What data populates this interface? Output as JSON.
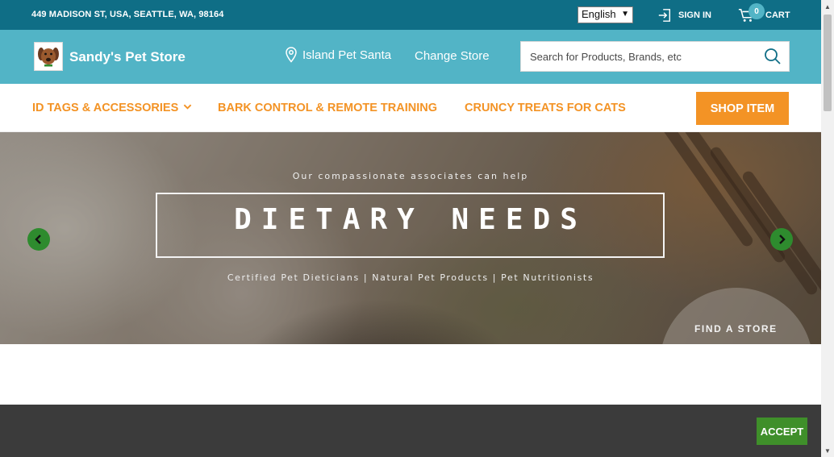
{
  "topbar": {
    "address": "449 MADISON ST, USA, SEATTLE, WA, 98164",
    "language": "English",
    "signin_label": "SIGN IN",
    "cart_label": "CART",
    "cart_count": "0"
  },
  "header": {
    "brand_name": "Sandy's Pet Store",
    "store_name": "Island Pet Santa",
    "change_store_label": "Change Store",
    "search_placeholder": "Search for Products, Brands, etc"
  },
  "nav": {
    "items": [
      {
        "label": "ID TAGS & ACCESSORIES",
        "has_dropdown": true
      },
      {
        "label": "BARK CONTROL & REMOTE TRAINING"
      },
      {
        "label": "CRUNCY TREATS FOR CATS"
      }
    ],
    "shop_button": "SHOP ITEM"
  },
  "hero": {
    "tagline_top": "Our compassionate associates can help",
    "headline": "DIETARY NEEDS",
    "tagline_bottom": "Certified Pet Dieticians | Natural Pet Products | Pet Nutritionists",
    "find_store_label": "FIND A STORE"
  },
  "cookie": {
    "accept_label": "ACCEPT"
  },
  "colors": {
    "topbar_bg": "#0f6e86",
    "brandbar_bg": "#52b4c6",
    "accent_orange": "#f39325",
    "arrow_green": "#2e8b2e",
    "accept_green": "#3f8f2a"
  },
  "icons": {
    "signin": "signin-icon",
    "cart": "cart-icon",
    "location": "location-pin-icon",
    "search": "search-icon",
    "dropdown": "chevron-down-icon",
    "prev": "chevron-left-icon",
    "next": "chevron-right-icon"
  }
}
